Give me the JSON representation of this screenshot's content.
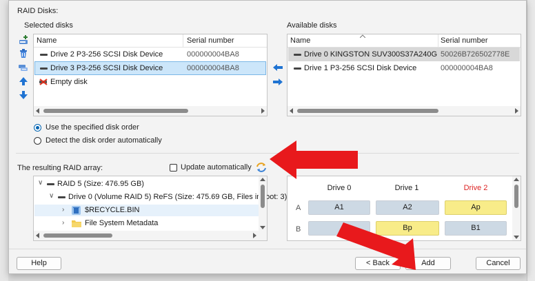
{
  "raid_disks_label": "RAID Disks:",
  "selected": {
    "title": "Selected disks",
    "columns": [
      "Name",
      "Serial number"
    ],
    "rows": [
      {
        "name": "Drive 2 P3-256  SCSI Disk Device",
        "serial": "000000004BA8"
      },
      {
        "name": "Drive 3 P3-256  SCSI Disk Device",
        "serial": "000000004BA8"
      },
      {
        "name": "Empty disk",
        "serial": ""
      }
    ]
  },
  "available": {
    "title": "Available disks",
    "columns": [
      "Name",
      "Serial number"
    ],
    "rows": [
      {
        "name": "Drive 0 KINGSTON SUV300S37A240G",
        "serial": "50026B726502778E"
      },
      {
        "name": "Drive 1 P3-256  SCSI Disk Device",
        "serial": "000000004BA8"
      }
    ]
  },
  "order": {
    "specified": "Use the specified disk order",
    "auto": "Detect the disk order automatically"
  },
  "result": {
    "label": "The resulting RAID array:",
    "update_auto": "Update automatically",
    "tree": {
      "raid": "RAID 5 (Size: 476.95 GB)",
      "drive": "Drive 0 (Volume RAID 5) ReFS (Size: 475.69 GB, Files in root: 3)",
      "recycle": "$RECYCLE.BIN",
      "fsmeta": "File System Metadata"
    }
  },
  "layout": {
    "drives": [
      "Drive 0",
      "Drive 1",
      "Drive 2"
    ],
    "rows": [
      {
        "label": "A",
        "blocks": [
          "A1",
          "A2",
          "Ap"
        ]
      },
      {
        "label": "B",
        "blocks": [
          "",
          "Bp",
          "B1"
        ]
      }
    ]
  },
  "buttons": {
    "help": "Help",
    "back": "< Back",
    "add": "Add",
    "cancel": "Cancel"
  },
  "colors": {
    "accent": "#0063b1",
    "annotation_arrow": "#e8191c",
    "parity_block": "#f8ec89",
    "data_block": "#cdd9e4"
  }
}
